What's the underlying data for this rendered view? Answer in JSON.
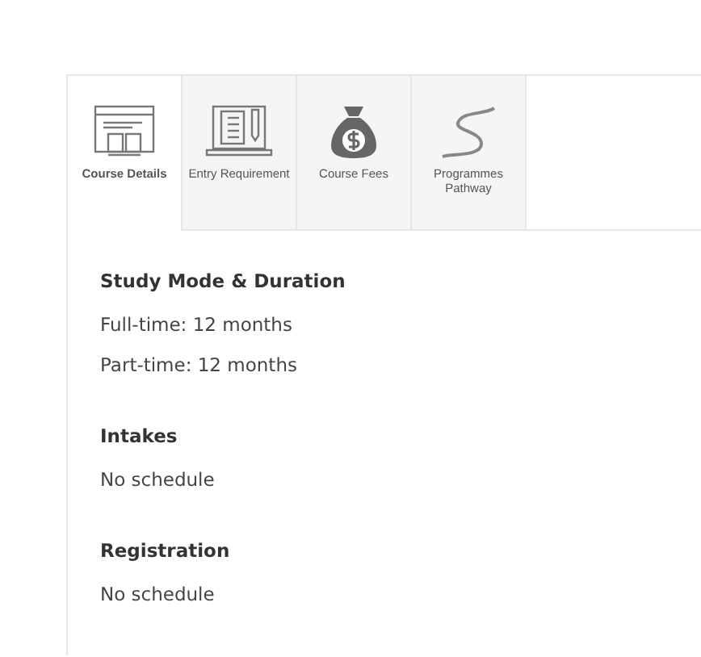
{
  "tabs": [
    {
      "label": "Course Details",
      "selected": true
    },
    {
      "label": "Entry Requirement",
      "selected": false
    },
    {
      "label": "Course Fees",
      "selected": false
    },
    {
      "label": "Programmes Pathway",
      "selected": false
    }
  ],
  "sections": [
    {
      "title": "Study Mode & Duration",
      "lines": [
        "Full-time: 12 months",
        "Part-time: 12 months"
      ]
    },
    {
      "title": "Intakes",
      "lines": [
        "No schedule"
      ]
    },
    {
      "title": "Registration",
      "lines": [
        "No schedule"
      ]
    }
  ]
}
